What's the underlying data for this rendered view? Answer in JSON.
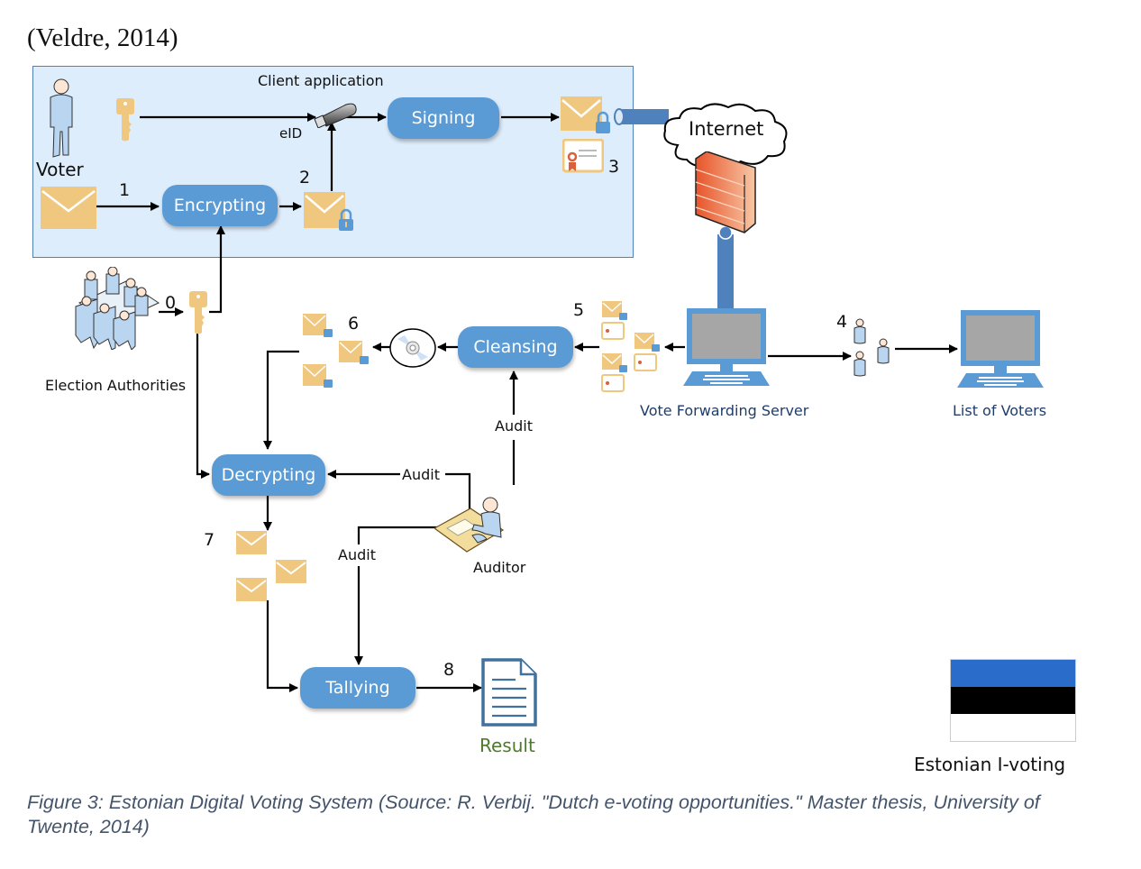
{
  "citation": "(Veldre, 2014)",
  "client_app": {
    "title": "Client application",
    "voter_label": "Voter",
    "eid_label": "eID"
  },
  "processes": {
    "encrypting": "Encrypting",
    "signing": "Signing",
    "cleansing": "Cleansing",
    "decrypting": "Decrypting",
    "tallying": "Tallying"
  },
  "steps": [
    "0",
    "1",
    "2",
    "3",
    "4",
    "5",
    "6",
    "7",
    "8"
  ],
  "nodes": {
    "internet": "Internet",
    "election_authorities": "Election Authorities",
    "vote_forwarding_server": "Vote Forwarding Server",
    "list_of_voters": "List of Voters",
    "auditor": "Auditor",
    "result": "Result",
    "estonian_ivoting": "Estonian I-voting"
  },
  "audit_labels": [
    "Audit",
    "Audit",
    "Audit"
  ],
  "flag_colors": [
    "#2a6cc9",
    "#000000",
    "#ffffff"
  ],
  "colors": {
    "process": "#5b9bd5",
    "envelope": "#f0c77f",
    "client_box": "#deedfc",
    "result_text": "#4e7a2c",
    "node_text": "#1f3d6b"
  },
  "caption": "Figure 3: Estonian Digital Voting System (Source: R. Verbij. \"Dutch e-voting opportunities.\" Master thesis, University of Twente, 2014)"
}
